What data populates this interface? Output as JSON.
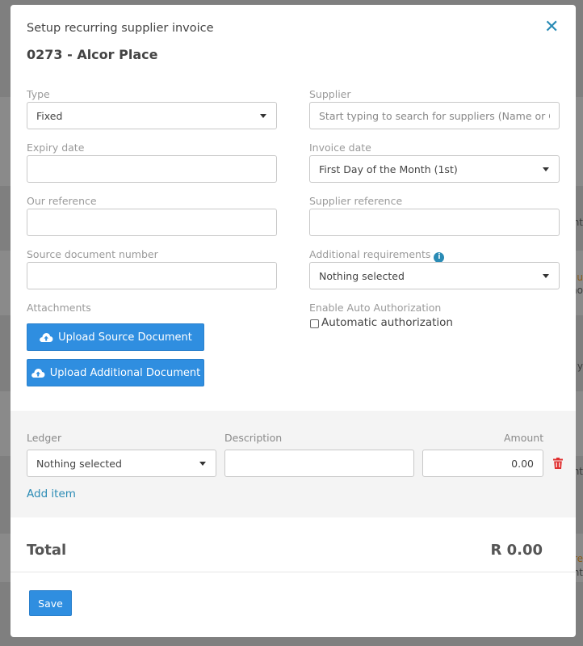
{
  "background": {
    "fragments": [
      "nt",
      "u",
      "no",
      "y",
      "nt",
      "re",
      "nt"
    ]
  },
  "modal": {
    "title": "Setup recurring supplier invoice",
    "subtitle": "0273 - Alcor Place",
    "close_icon": "close-icon"
  },
  "form": {
    "type": {
      "label": "Type",
      "value": "Fixed"
    },
    "supplier": {
      "label": "Supplier",
      "placeholder": "Start typing to search for suppliers (Name or Code)"
    },
    "expiry_date": {
      "label": "Expiry date",
      "value": ""
    },
    "invoice_date": {
      "label": "Invoice date",
      "value": "First Day of the Month (1st)"
    },
    "our_reference": {
      "label": "Our reference",
      "value": ""
    },
    "supplier_reference": {
      "label": "Supplier reference",
      "value": ""
    },
    "source_document_number": {
      "label": "Source document number",
      "value": ""
    },
    "additional_requirements": {
      "label": "Additional requirements",
      "info_icon": "info-icon",
      "value": "Nothing selected"
    },
    "attachments": {
      "label": "Attachments",
      "upload_source_label": "Upload Source Document",
      "upload_additional_label": "Upload Additional Document",
      "icon": "cloud-upload-icon"
    },
    "auto_authorization": {
      "label": "Enable Auto Authorization",
      "checkbox_label": "Automatic authorization",
      "checked": false
    }
  },
  "ledger": {
    "headers": {
      "ledger": "Ledger",
      "description": "Description",
      "amount": "Amount"
    },
    "rows": [
      {
        "ledger": "Nothing selected",
        "description": "",
        "amount": "0.00"
      }
    ],
    "add_item_label": "Add item",
    "delete_icon": "trash-icon"
  },
  "total": {
    "label": "Total",
    "value": "R 0.00"
  },
  "footer": {
    "save_label": "Save"
  },
  "colors": {
    "primary": "#2f8ee0",
    "link": "#2a8bb5",
    "danger": "#e03030"
  }
}
